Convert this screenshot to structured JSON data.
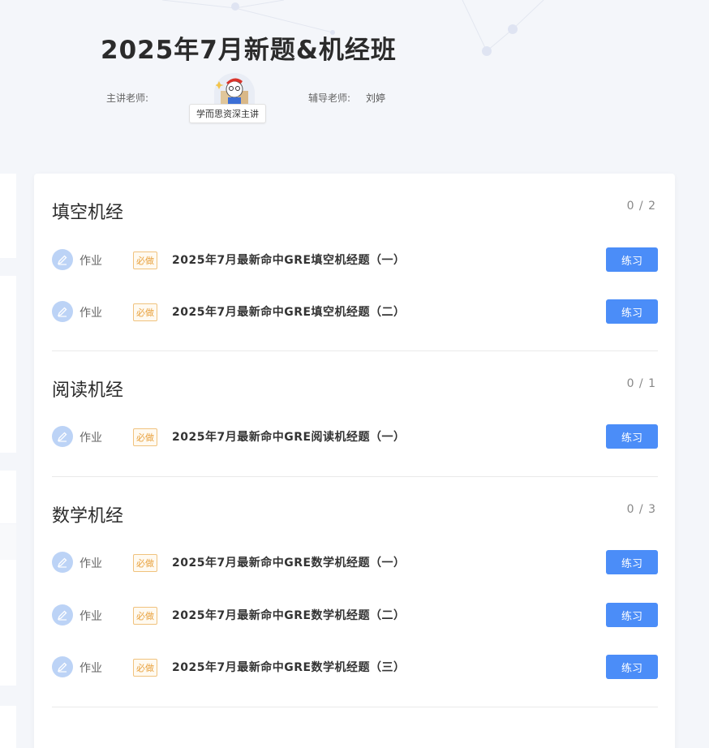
{
  "header": {
    "course_title": "2025年7月新题&机经班",
    "teacher_label": "主讲老师:",
    "teacher_tag": "学而思资深主讲",
    "tutor_label": "辅导老师:",
    "tutor_name": "刘婷"
  },
  "colors": {
    "accent": "#4b8df8",
    "badge": "#e8a13d",
    "icon_bg": "#bcd3f6"
  },
  "sections": [
    {
      "title": "填空机经",
      "progress": "0 / 2",
      "items": [
        {
          "type": "作业",
          "badge": "必做",
          "title": "2025年7月最新命中GRE填空机经题（一）",
          "button": "练习"
        },
        {
          "type": "作业",
          "badge": "必做",
          "title": "2025年7月最新命中GRE填空机经题（二）",
          "button": "练习"
        }
      ]
    },
    {
      "title": "阅读机经",
      "progress": "0 / 1",
      "items": [
        {
          "type": "作业",
          "badge": "必做",
          "title": "2025年7月最新命中GRE阅读机经题（一）",
          "button": "练习"
        }
      ]
    },
    {
      "title": "数学机经",
      "progress": "0 / 3",
      "items": [
        {
          "type": "作业",
          "badge": "必做",
          "title": "2025年7月最新命中GRE数学机经题（一）",
          "button": "练习"
        },
        {
          "type": "作业",
          "badge": "必做",
          "title": "2025年7月最新命中GRE数学机经题（二）",
          "button": "练习"
        },
        {
          "type": "作业",
          "badge": "必做",
          "title": "2025年7月最新命中GRE数学机经题（三）",
          "button": "练习"
        }
      ]
    }
  ]
}
